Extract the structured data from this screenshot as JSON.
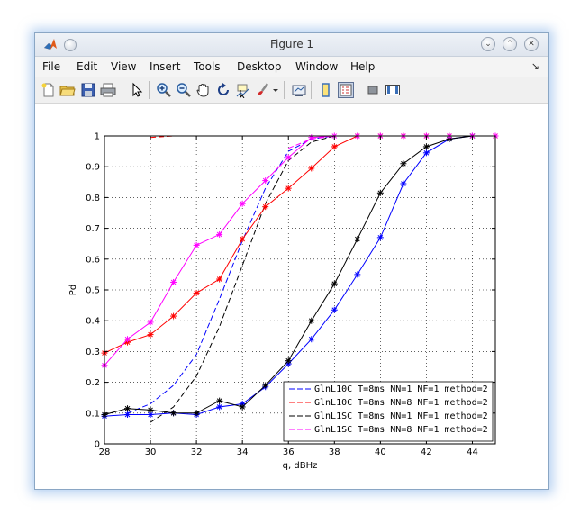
{
  "window": {
    "title": "Figure 1"
  },
  "menu": {
    "items": [
      "File",
      "Edit",
      "View",
      "Insert",
      "Tools",
      "Desktop",
      "Window",
      "Help"
    ],
    "arrow": "↘"
  },
  "toolbar": {
    "icons": [
      "new-figure-icon",
      "open-file-icon",
      "save-icon",
      "print-icon",
      "pointer-icon",
      "zoom-in-icon",
      "zoom-out-icon",
      "pan-icon",
      "rotate-3d-icon",
      "data-cursor-icon",
      "brush-icon",
      "link-plot-icon",
      "colorbar-icon",
      "legend-icon",
      "hide-plot-tools-icon",
      "show-plot-tools-icon"
    ]
  },
  "chart_data": {
    "type": "line",
    "xlabel": "q, dBHz",
    "ylabel": "Pd",
    "xlim": [
      28,
      45
    ],
    "ylim": [
      0,
      1
    ],
    "xticks": [
      28,
      30,
      32,
      34,
      36,
      38,
      40,
      42,
      44
    ],
    "yticks": [
      0,
      0.1,
      0.2,
      0.3,
      0.4,
      0.5,
      0.6,
      0.7,
      0.8,
      0.9,
      1
    ],
    "grid": true,
    "legend_position": "bottom-right",
    "series": [
      {
        "name": "GlnL10C T=8ms NN=1 NF=1 method=2",
        "color": "#0000ff",
        "style": "dashed",
        "marker": "none",
        "x": [
          29,
          30,
          31,
          32,
          33,
          34,
          35,
          36,
          37,
          38,
          39,
          40,
          41,
          42,
          43,
          44,
          45
        ],
        "y": [
          0.1,
          0.13,
          0.19,
          0.29,
          0.47,
          0.66,
          0.83,
          0.95,
          0.99,
          1.0,
          1.0,
          1.0,
          1.0,
          1.0,
          1.0,
          1.0,
          1.0
        ]
      },
      {
        "name": "GlnL10C T=8ms NN=8 NF=1 method=2",
        "color": "#ff0000",
        "style": "dashed",
        "marker": "none",
        "x": [
          30,
          31,
          32,
          33,
          34,
          35,
          36,
          37,
          38,
          39,
          40,
          41,
          42,
          43,
          44,
          45
        ],
        "y": [
          0.995,
          1.0,
          1.0,
          1.0,
          1.0,
          1.0,
          1.0,
          1.0,
          1.0,
          1.0,
          1.0,
          1.0,
          1.0,
          1.0,
          1.0,
          1.0
        ]
      },
      {
        "name": "GlnL1SC T=8ms NN=1 NF=1 method=2",
        "color": "#000000",
        "style": "dashed",
        "marker": "none",
        "x": [
          30,
          31,
          32,
          33,
          34,
          35,
          36,
          37,
          38,
          39,
          40,
          41,
          42,
          43,
          44,
          45
        ],
        "y": [
          0.07,
          0.12,
          0.22,
          0.38,
          0.58,
          0.78,
          0.92,
          0.98,
          1.0,
          1.0,
          1.0,
          1.0,
          1.0,
          1.0,
          1.0,
          1.0
        ]
      },
      {
        "name": "GlnL1SC T=8ms NN=8 NF=1 method=2",
        "color": "#ff00ff",
        "style": "dashed",
        "marker": "none",
        "x": [
          36,
          37,
          38,
          39,
          40,
          41,
          42,
          43,
          44,
          45
        ],
        "y": [
          0.96,
          0.99,
          1.0,
          1.0,
          1.0,
          1.0,
          1.0,
          1.0,
          1.0,
          1.0
        ]
      },
      {
        "name": "",
        "color": "#0000ff",
        "style": "solid",
        "marker": "*",
        "x": [
          28,
          29,
          30,
          31,
          32,
          33,
          34,
          35,
          36,
          37,
          38,
          39,
          40,
          41,
          42,
          43,
          44
        ],
        "y": [
          0.09,
          0.095,
          0.095,
          0.1,
          0.095,
          0.12,
          0.13,
          0.185,
          0.26,
          0.34,
          0.435,
          0.55,
          0.67,
          0.845,
          0.945,
          0.99,
          1.0
        ]
      },
      {
        "name": "",
        "color": "#ff0000",
        "style": "solid",
        "marker": "*",
        "x": [
          28,
          29,
          30,
          31,
          32,
          33,
          34,
          35,
          36,
          37,
          38,
          39,
          40,
          41,
          42,
          43,
          44,
          45
        ],
        "y": [
          0.295,
          0.33,
          0.355,
          0.415,
          0.49,
          0.535,
          0.665,
          0.77,
          0.83,
          0.895,
          0.965,
          1.0,
          1.0,
          1.0,
          1.0,
          1.0,
          1.0,
          1.0
        ]
      },
      {
        "name": "",
        "color": "#000000",
        "style": "solid",
        "marker": "*",
        "x": [
          28,
          29,
          30,
          31,
          32,
          33,
          34,
          35,
          36,
          37,
          38,
          39,
          40,
          41,
          42,
          43,
          44
        ],
        "y": [
          0.095,
          0.115,
          0.11,
          0.1,
          0.1,
          0.14,
          0.12,
          0.19,
          0.27,
          0.4,
          0.52,
          0.665,
          0.815,
          0.91,
          0.965,
          0.99,
          1.0
        ]
      },
      {
        "name": "",
        "color": "#ff00ff",
        "style": "solid",
        "marker": "*",
        "x": [
          28,
          29,
          30,
          31,
          32,
          33,
          34,
          35,
          36,
          37,
          38,
          39,
          40,
          41,
          42,
          43,
          44,
          45
        ],
        "y": [
          0.255,
          0.34,
          0.395,
          0.525,
          0.645,
          0.68,
          0.78,
          0.855,
          0.93,
          0.995,
          1.0,
          1.0,
          1.0,
          1.0,
          1.0,
          1.0,
          1.0,
          1.0
        ]
      }
    ]
  }
}
